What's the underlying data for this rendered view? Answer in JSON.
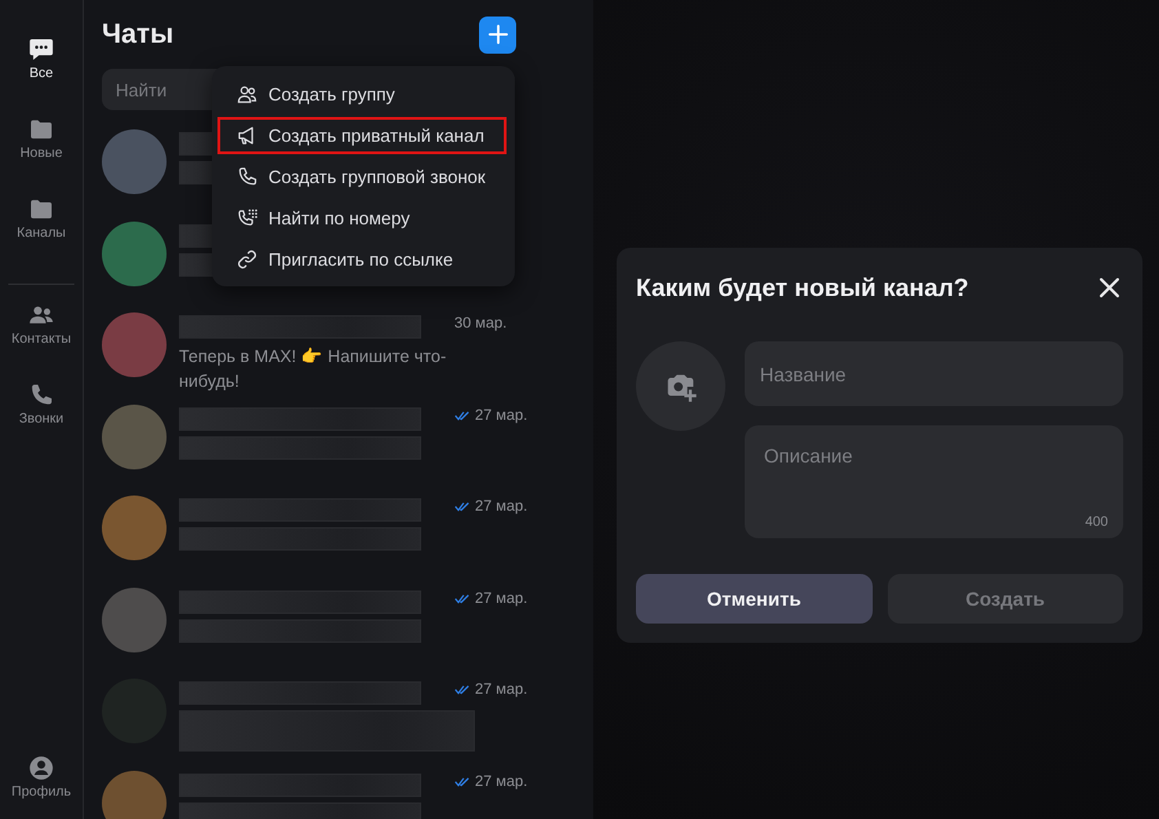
{
  "sidebar": {
    "items": [
      {
        "label": "Все",
        "kind": "chat",
        "selected": true
      },
      {
        "label": "Новые",
        "kind": "folder",
        "selected": false
      },
      {
        "label": "Каналы",
        "kind": "folder",
        "selected": false
      },
      {
        "label": "Контакты",
        "kind": "contacts",
        "selected": false
      },
      {
        "label": "Звонки",
        "kind": "calls",
        "selected": false
      }
    ],
    "profile": {
      "label": "Профиль"
    }
  },
  "chat_list": {
    "title": "Чаты",
    "search": {
      "placeholder": "Найти"
    },
    "chats": [
      {
        "color": "#4a5260",
        "read": false
      },
      {
        "color": "#2c6b4c",
        "read": false
      },
      {
        "color": "#7a3c44",
        "date": "30 мар.",
        "read": false,
        "preview": "Теперь в MAX! 👉 Напишите что-нибудь!"
      },
      {
        "color": "#5a5548",
        "date": "27 мар.",
        "read": true
      },
      {
        "color": "#7a5630",
        "date": "27 мар.",
        "read": true
      },
      {
        "color": "#4e4c4c",
        "date": "27 мар.",
        "read": true
      },
      {
        "color": "#1f2422",
        "date": "27 мар.",
        "read": true
      },
      {
        "color": "#6e5030",
        "date": "27 мар.",
        "read": true
      }
    ]
  },
  "menu": {
    "items": [
      {
        "label": "Создать группу",
        "kind": "group",
        "highlighted": false
      },
      {
        "label": "Создать приватный канал",
        "kind": "channel",
        "highlighted": true
      },
      {
        "label": "Создать групповой звонок",
        "kind": "call",
        "highlighted": false
      },
      {
        "label": "Найти по номеру",
        "kind": "number",
        "highlighted": false
      },
      {
        "label": "Пригласить по ссылке",
        "kind": "invite",
        "highlighted": false
      }
    ]
  },
  "dialog": {
    "title": "Каким будет новый канал?",
    "name_field": {
      "placeholder": "Название"
    },
    "description_field": {
      "placeholder": "Описание",
      "counter": "400"
    },
    "buttons": [
      {
        "label": "Отменить",
        "disabled": false
      },
      {
        "label": "Создать",
        "disabled": true
      }
    ]
  }
}
